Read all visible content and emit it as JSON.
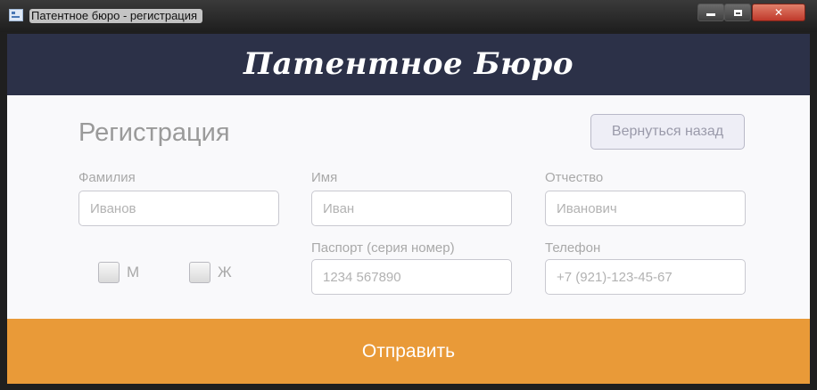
{
  "window": {
    "title": "Патентное бюро - регистрация",
    "buttons": {
      "minimize": "minimize",
      "maximize": "maximize",
      "close": "✕"
    }
  },
  "header": {
    "brand": "Патентное Бюро"
  },
  "form": {
    "title": "Регистрация",
    "back_button": "Вернуться назад",
    "fields": {
      "surname": {
        "label": "Фамилия",
        "placeholder": "Иванов",
        "value": ""
      },
      "name": {
        "label": "Имя",
        "placeholder": "Иван",
        "value": ""
      },
      "patronymic": {
        "label": "Отчество",
        "placeholder": "Иванович",
        "value": ""
      },
      "passport": {
        "label": "Паспорт (серия номер)",
        "placeholder": "1234 567890",
        "value": ""
      },
      "phone": {
        "label": "Телефон",
        "placeholder": "+7 (921)-123-45-67",
        "value": ""
      }
    },
    "gender": {
      "male": {
        "label": "М",
        "checked": false
      },
      "female": {
        "label": "Ж",
        "checked": false
      }
    },
    "submit": "Отправить"
  },
  "colors": {
    "header_bg": "#2c3148",
    "accent": "#e99a38",
    "content_bg": "#f9f9fb"
  }
}
